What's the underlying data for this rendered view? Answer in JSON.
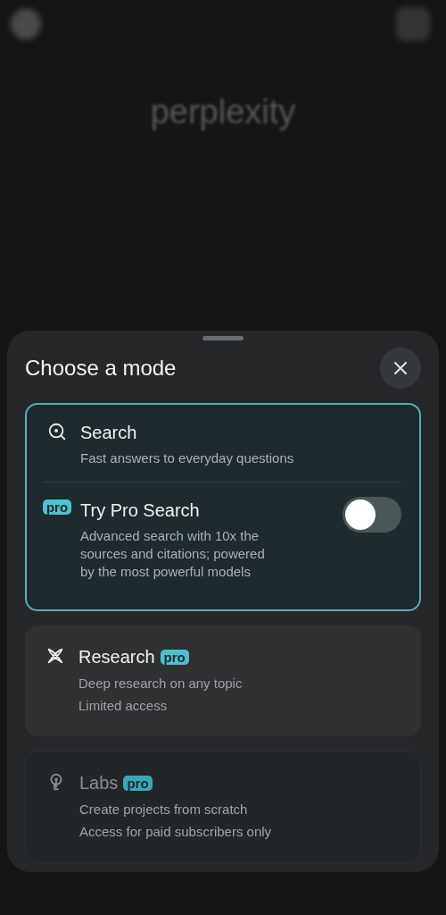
{
  "background": {
    "logo": "perplexity"
  },
  "sheet": {
    "title": "Choose a mode"
  },
  "modes": [
    {
      "kind": "group",
      "selected": true,
      "items": [
        {
          "title": "Search",
          "description": "Fast answers to everyday questions"
        },
        {
          "leading_badge": "pro",
          "title": "Try Pro Search",
          "description": "Advanced search with 10x the sources and citations; powered by the most powerful models",
          "on": false
        }
      ]
    },
    {
      "kind": "card",
      "disabled": false,
      "title": "Research",
      "badge": "pro",
      "lines": [
        "Deep research on any topic",
        "Limited access"
      ]
    },
    {
      "kind": "card",
      "disabled": true,
      "title": "Labs",
      "badge": "pro",
      "lines": [
        "Create projects from scratch",
        "Access for paid subscribers only"
      ]
    }
  ]
}
